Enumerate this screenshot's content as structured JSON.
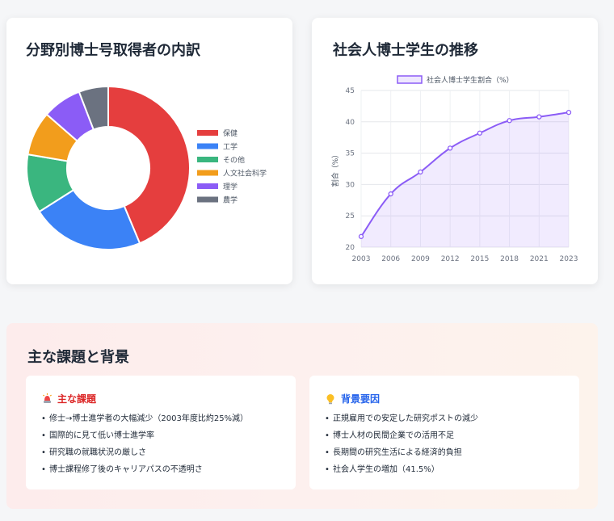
{
  "donut_card": {
    "title": "分野別博士号取得者の内訳"
  },
  "line_card": {
    "title": "社会人博士学生の推移"
  },
  "chart_data": [
    {
      "type": "pie",
      "title": "分野別博士号取得者の内訳",
      "categories": [
        "保健",
        "工学",
        "その他",
        "人文社会科学",
        "理学",
        "農学"
      ],
      "values": [
        45,
        23,
        12,
        9,
        8,
        6
      ],
      "colors": [
        "#e53e3e",
        "#3b82f6",
        "#3ab67f",
        "#f29d1c",
        "#8b5cf6",
        "#6b7280"
      ],
      "legend": "right",
      "donut": true
    },
    {
      "type": "area",
      "title": "社会人博士学生の推移",
      "x": [
        "2003",
        "2006",
        "2009",
        "2012",
        "2015",
        "2018",
        "2021",
        "2023"
      ],
      "series": [
        {
          "name": "社会人博士学生割合（%）",
          "values": [
            21.7,
            28.5,
            32.0,
            35.8,
            38.2,
            40.2,
            40.8,
            41.5
          ],
          "color": "#8b5cf6"
        }
      ],
      "xlabel": "",
      "ylabel": "割合（%）",
      "ylim": [
        20,
        45
      ],
      "yticks": [
        20,
        25,
        30,
        35,
        40,
        45
      ],
      "grid": true,
      "legend": "top"
    }
  ],
  "issues_section": {
    "title": "主な課題と背景",
    "issues": {
      "heading": "主な課題",
      "icon": "alarm-light-icon",
      "items": [
        "修士→博士進学者の大幅減少（2003年度比約25%減）",
        "国際的に見て低い博士進学率",
        "研究職の就職状況の厳しさ",
        "博士課程修了後のキャリアパスの不透明さ"
      ]
    },
    "background": {
      "heading": "背景要因",
      "icon": "lightbulb-icon",
      "items": [
        "正規雇用での安定した研究ポストの減少",
        "博士人材の民間企業での活用不足",
        "長期間の研究生活による経済的負担",
        "社会人学生の増加（41.5%）"
      ]
    }
  }
}
